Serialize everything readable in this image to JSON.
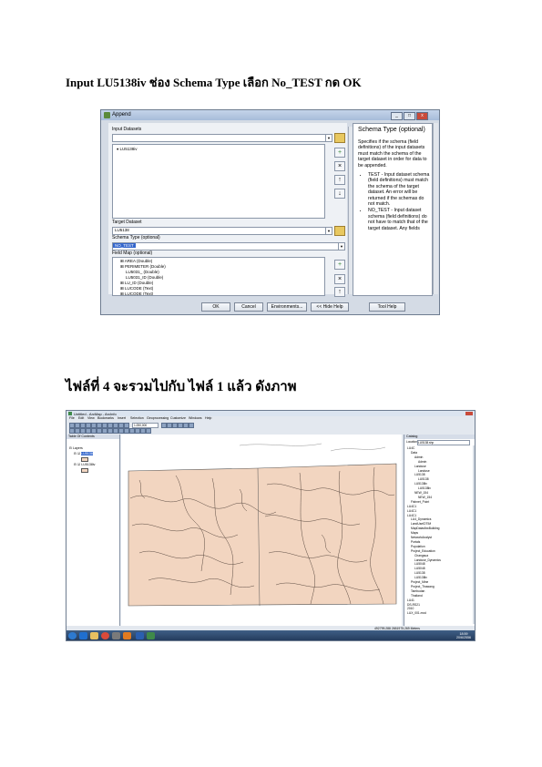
{
  "headings": {
    "step_one": "Input LU5138iv ช่อง Schema Type เลือก No_TEST กด OK",
    "step_two": "ไฟล์ที่ 4 จะรวมไปกับ ไฟล์ 1 แล้ว ดังภาพ"
  },
  "append_dialog": {
    "title": "Append",
    "input_datasets_label": "Input Datasets",
    "input_items": [
      "LU5138iv"
    ],
    "target_dataset_label": "Target Dataset",
    "target_value": "LU5138",
    "schema_type_label": "Schema Type (optional)",
    "schema_type_value": "NO_TEST",
    "field_map_label": "Field Map (optional)",
    "fields": [
      "AREA (Double)",
      "PERIMETER (Double)",
      "LU5031_ (Double)",
      "LU5031_ID (Double)",
      "LU_ID (Double)",
      "LUCODE (Text)",
      "LUCODE (Text)"
    ],
    "help": {
      "title": "Schema Type (optional)",
      "body": "Specifies if the schema (field definitions) of the input datasets must match the schema of the target dataset in order for data to be appended.",
      "bullets": [
        "TEST - Input dataset schema (field definitions) must match the schema of the target dataset. An error will be returned if the schemas do not match.",
        "NO_TEST - Input dataset schema (field definitions) do not have to match that of the target dataset. Any fields"
      ]
    },
    "buttons": {
      "ok": "OK",
      "cancel": "Cancel",
      "environments": "Environments...",
      "hide_help": "<< Hide Help",
      "tool_help": "Tool Help"
    }
  },
  "arcmap": {
    "title": "Untitled - ArcMap - ArcInfo",
    "menu": [
      "File",
      "Edit",
      "View",
      "Bookmarks",
      "Insert",
      "Selection",
      "Geoprocessing",
      "Customize",
      "Windows",
      "Help"
    ],
    "scale": "1:250,000",
    "toc_title": "Table Of Contents",
    "toc_items": [
      "Layers",
      "LU5138",
      "LU5138iv"
    ],
    "catalog_title": "Catalog",
    "catalog_location_label": "Location:",
    "catalog_location": "LU5138.shp",
    "catalog_items": [
      "LU4C",
      "Data",
      "Admin",
      "Admin",
      "Landuse",
      "Landuse",
      "LU5138",
      "LU5138",
      "LU5138iv",
      "LU5138iv",
      "NEW_154",
      "NEW_154",
      "Fishnet_Point",
      "LU4C1",
      "LU4C1",
      "LU4C1",
      "LU4_Dynamics",
      "LandUseIDTIM",
      "MapDatasNwBuilding",
      "Maps",
      "NetworkAnalyst",
      "Portals",
      "Population",
      "Project_Education",
      "Changsua",
      "Landuse_Dynamics",
      "LU5048",
      "LU5048",
      "LU5138",
      "LU5138iv",
      "Project_Mine",
      "Project_Thawang",
      "Tambudan",
      "Thailand",
      "LU41",
      "DS-RS21",
      "2010",
      "LUX_001.mxd"
    ],
    "status": "492799.288  2651975.269 Meters",
    "clock_time": "18:59",
    "clock_date": "20/6/2556"
  }
}
